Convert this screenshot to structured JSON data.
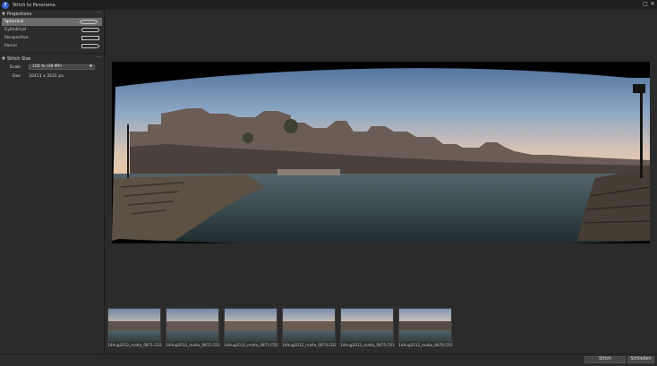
{
  "window": {
    "title": "Stitch to Panorama",
    "icon": "app-logo-icon",
    "maximize_glyph": "□",
    "close_glyph": "✕"
  },
  "left_panel": {
    "projections": {
      "header": "Projections",
      "items": [
        {
          "label": "Spherical",
          "selected": true,
          "icon": "spherical-projection-icon"
        },
        {
          "label": "Cylindrical",
          "selected": false,
          "icon": "cylindrical-projection-icon"
        },
        {
          "label": "Perspective",
          "selected": false,
          "icon": "perspective-projection-icon"
        },
        {
          "label": "Panini",
          "selected": false,
          "icon": "panini-projection-icon"
        }
      ]
    },
    "stitch_size": {
      "header": "Stitch Size",
      "scale_label": "Scale",
      "scale_value": "100 % (38 MP)",
      "size_label": "Size",
      "size_value": "10411 x 3521 px"
    }
  },
  "filmstrip": {
    "items": [
      {
        "filename": "14Aug2012_malta_0871.CR2"
      },
      {
        "filename": "14Aug2012_malta_0872.CR2"
      },
      {
        "filename": "14Aug2012_malta_0873.CR2"
      },
      {
        "filename": "14Aug2012_malta_0874.CR2"
      },
      {
        "filename": "14Aug2012_malta_0875.CR2"
      },
      {
        "filename": "14Aug2012_malta_0876.CR2"
      }
    ]
  },
  "bottom_bar": {
    "stitch_label": "Stitch",
    "close_label": "Schließen"
  },
  "colors": {
    "background": "#2b2b2b",
    "selected_row": "#6c6c6c",
    "titlebar": "#1f1f1f"
  }
}
